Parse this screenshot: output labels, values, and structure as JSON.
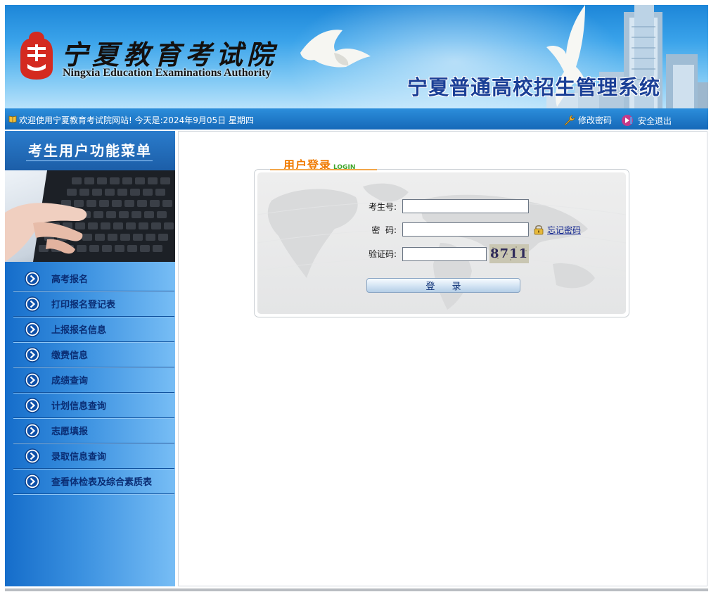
{
  "header": {
    "org_name_cn": "宁夏教育考试院",
    "org_name_en": "Ningxia Education Examinations Authority",
    "system_title": "宁夏普通高校招生管理系统"
  },
  "welcome_bar": {
    "welcome_text": "欢迎使用宁夏教育考试院网站!  今天是:2024年9月05日 星期四",
    "edit_password": "修改密码",
    "logout": "安全退出"
  },
  "sidebar": {
    "title": "考生用户功能菜单",
    "items": [
      {
        "label": "高考报名"
      },
      {
        "label": "打印报名登记表"
      },
      {
        "label": "上报报名信息"
      },
      {
        "label": "缴费信息"
      },
      {
        "label": "成绩查询"
      },
      {
        "label": "计划信息查询"
      },
      {
        "label": "志愿填报"
      },
      {
        "label": "录取信息查询"
      },
      {
        "label": "查看体检表及综合素质表"
      }
    ]
  },
  "login": {
    "tab_title_cn": "用户登录",
    "tab_title_en": "LOGIN",
    "exam_id_label": "考生号:",
    "exam_id_value": "",
    "password_label": "密  码:",
    "password_value": "",
    "forgot_password": "忘记密码",
    "captcha_label": "验证码:",
    "captcha_value": "",
    "captcha_code": "8711",
    "submit_label": "登 录"
  },
  "colors": {
    "banner_blue": "#1d86d8",
    "sidebar_blue": "#156dca",
    "menu_text": "#0a2d74",
    "login_orange": "#f07a00",
    "login_green": "#3ea52a"
  },
  "icons": {
    "welcome": "book-icon",
    "edit_password": "wrench-icon",
    "logout": "logout-icon",
    "menu_item": "circle-chevron-right-icon",
    "forgot_password": "lock-icon"
  }
}
